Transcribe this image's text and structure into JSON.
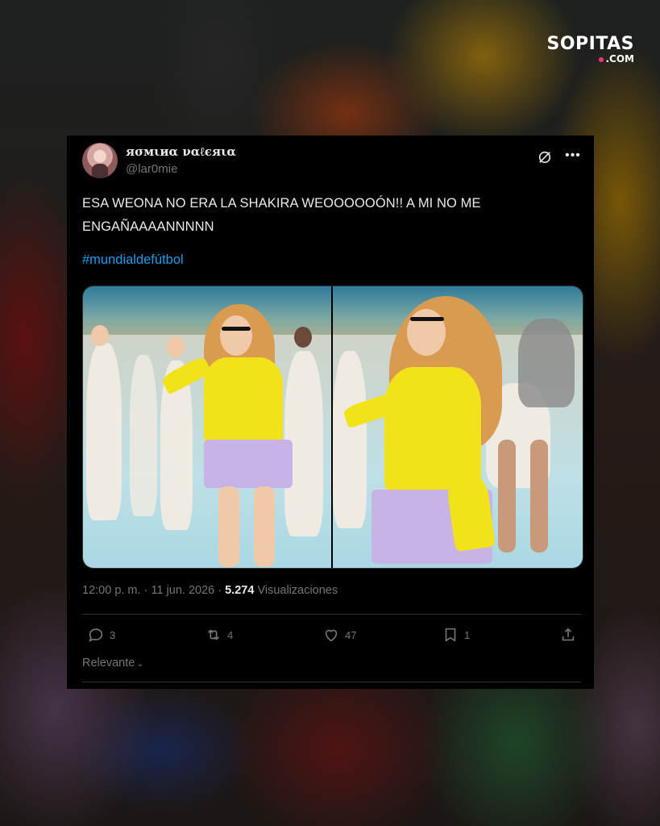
{
  "brand": {
    "logo_line1": "SOPITAS",
    "logo_line2": ".COM"
  },
  "tweet": {
    "display_name": "яσмιиα ναℓєяια",
    "handle": "@lar0mie",
    "body_line1": "ESA WEONA NO ERA LA SHAKIRA WEOOOOOÓN!! A MI NO ME",
    "body_line2": "ENGAÑAAAANNNNN",
    "hashtag": "#mundialdefútbol",
    "time": "12:00 p. m.",
    "date": "11 jun. 2026",
    "dot": "·",
    "views_count": "5.274",
    "views_label": "Visualizaciones",
    "replies": "3",
    "reposts": "4",
    "likes": "47",
    "bookmarks": "1",
    "sort_label": "Relevante"
  },
  "icons": [
    "grok-icon",
    "more-icon",
    "reply-icon",
    "repost-icon",
    "like-icon",
    "bookmark-icon",
    "share-icon",
    "chevron-down-icon"
  ],
  "colors": {
    "card_bg": "#000000",
    "text": "#e7e9ea",
    "muted": "#71767b",
    "link": "#1d9bf0",
    "divider": "#2f3336",
    "logo_dot": "#ff2d8a"
  }
}
